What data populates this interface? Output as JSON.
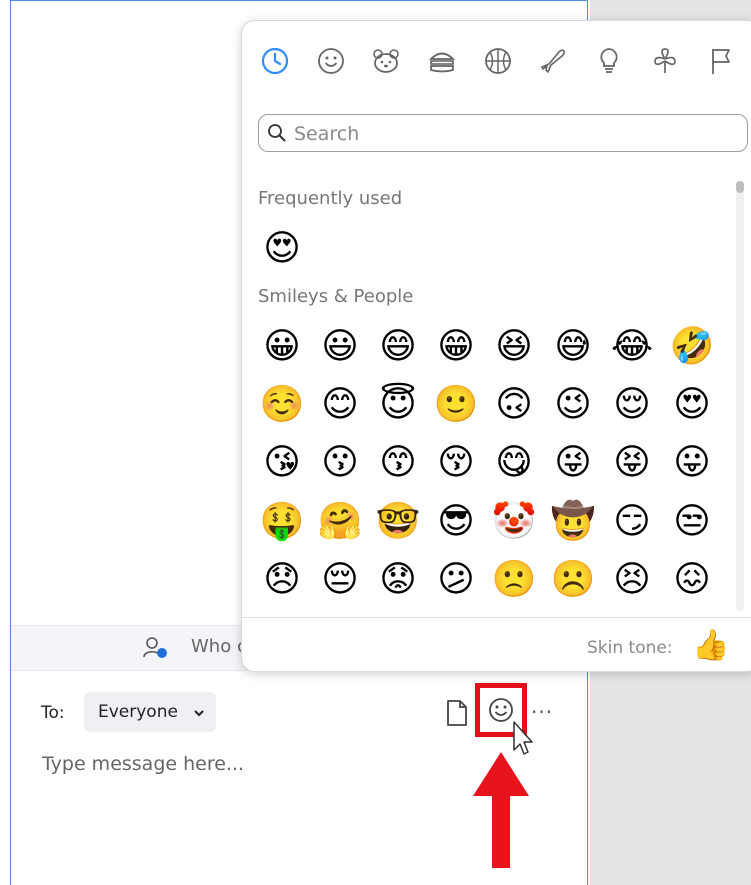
{
  "who_bar": {
    "text": "Who c"
  },
  "compose": {
    "to_label": "To:",
    "to_value": "Everyone",
    "message_placeholder": "Type message here...",
    "more_label": "···"
  },
  "emoji_picker": {
    "categories": [
      "recent-clock-icon",
      "smiley-icon",
      "animal-icon",
      "food-icon",
      "activity-ball-icon",
      "travel-plane-icon",
      "objects-bulb-icon",
      "nature-clover-icon",
      "flags-icon"
    ],
    "search_placeholder": "Search",
    "frequently_used_title": "Frequently used",
    "frequently_used": [
      "😍"
    ],
    "smileys_title": "Smileys & People",
    "smileys": [
      [
        "😀",
        "😃",
        "😄",
        "😁",
        "😆",
        "😅",
        "😂",
        "🤣"
      ],
      [
        "☺️",
        "😊",
        "😇",
        "🙂",
        "🙃",
        "😉",
        "😌",
        "😍"
      ],
      [
        "😘",
        "😗",
        "😙",
        "😚",
        "😋",
        "😜",
        "😝",
        "😛"
      ],
      [
        "🤑",
        "🤗",
        "🤓",
        "😎",
        "🤡",
        "🤠",
        "😏",
        "😒"
      ],
      [
        "😞",
        "😔",
        "😟",
        "😕",
        "🙁",
        "☹️",
        "😣",
        "😖"
      ]
    ],
    "skin_tone_label": "Skin tone:",
    "skin_tone_emoji": "👍"
  },
  "colors": {
    "accent_blue": "#2d8cff",
    "highlight_red": "#e3101a",
    "emoji_yellow": "#fcc21b"
  }
}
